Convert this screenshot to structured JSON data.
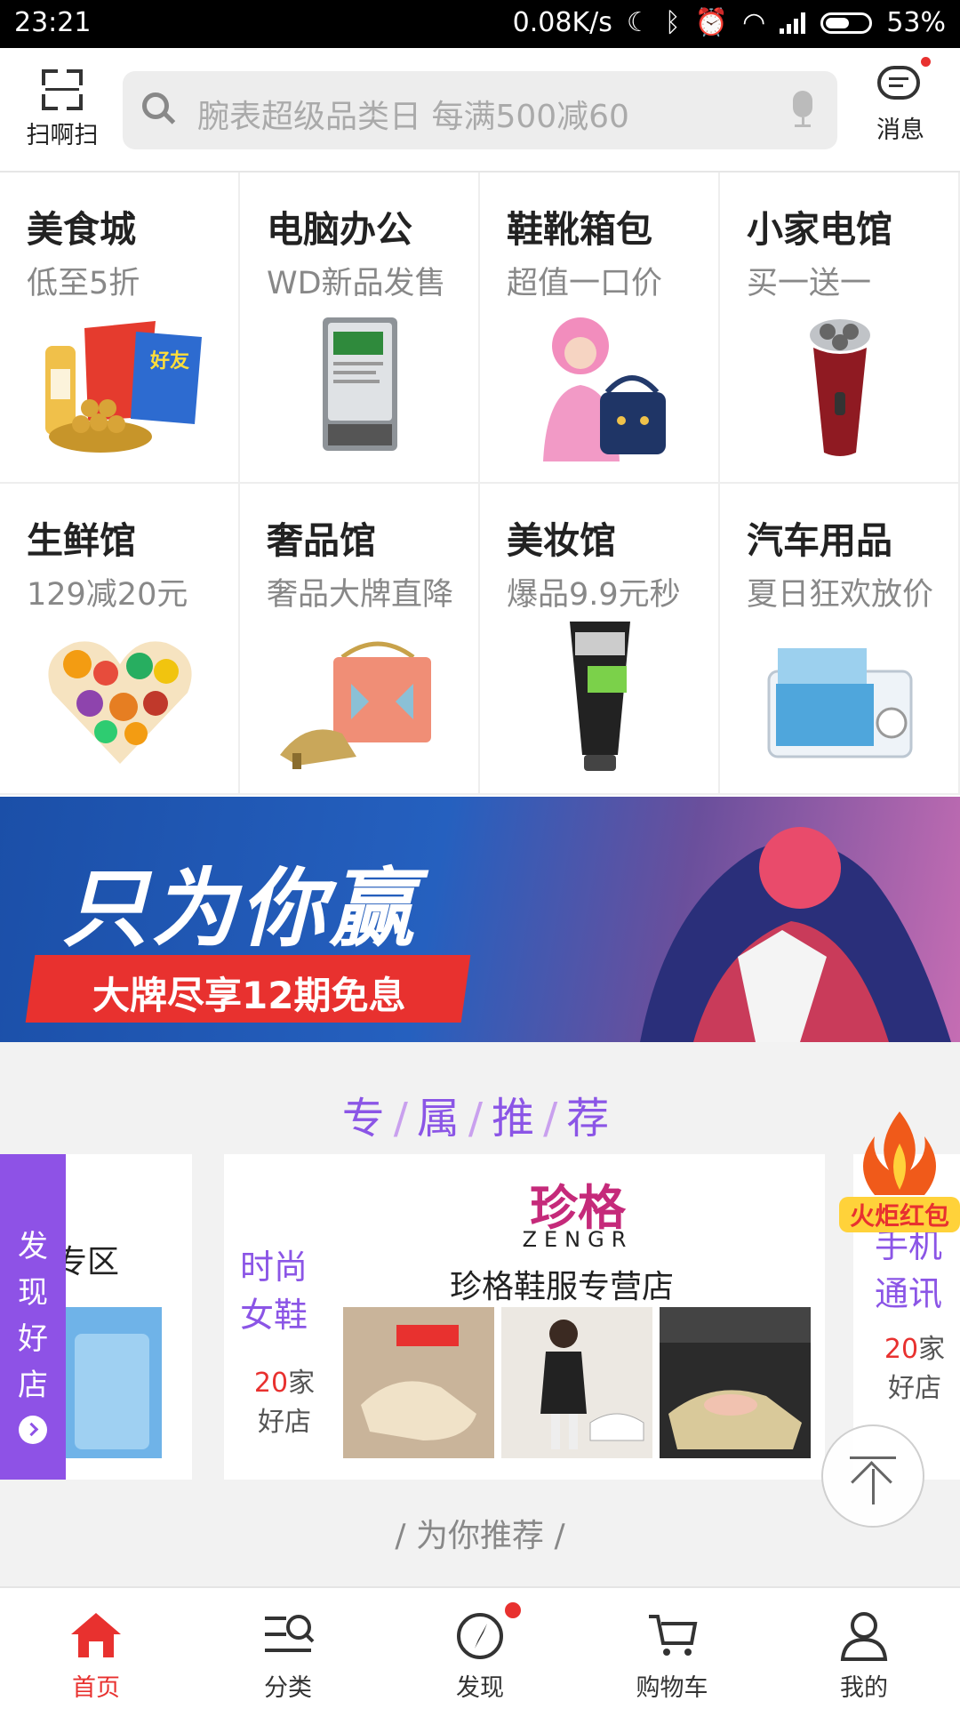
{
  "status_bar": {
    "time": "23:21",
    "speed": "0.08K/s",
    "battery": "53%",
    "battery_level": 0.53
  },
  "header": {
    "scan_label": "扫啊扫",
    "search_placeholder": "腕表超级品类日 每满500减60",
    "message_label": "消息"
  },
  "categories": [
    {
      "title": "美食城",
      "subtitle": "低至5折",
      "icon": "snack-food-image"
    },
    {
      "title": "电脑办公",
      "subtitle": "WD新品发售",
      "icon": "hard-drive-image"
    },
    {
      "title": "鞋靴箱包",
      "subtitle": "超值一口价",
      "icon": "handbag-model-image"
    },
    {
      "title": "小家电馆",
      "subtitle": "买一送一",
      "icon": "electric-shaver-image"
    },
    {
      "title": "生鲜馆",
      "subtitle": "129减20元",
      "icon": "fruit-heart-image"
    },
    {
      "title": "奢品馆",
      "subtitle": "奢品大牌直降",
      "icon": "luxury-bag-shoes-image"
    },
    {
      "title": "美妆馆",
      "subtitle": "爆品9.9元秒",
      "icon": "face-wash-image"
    },
    {
      "title": "汽车用品",
      "subtitle": "夏日狂欢放价",
      "icon": "car-fridge-image"
    }
  ],
  "banner": {
    "headline": "只为你赢",
    "tagline": "大牌尽享12期免息"
  },
  "recommend": {
    "title_chars": [
      "专",
      "属",
      "推",
      "荐"
    ],
    "left_card": {
      "partial_label": "专区"
    },
    "main_card": {
      "brand_logo": "珍格",
      "brand_en": "ZENGR",
      "shop_name": "珍格鞋服专营店",
      "category_lines": [
        "时尚",
        "女鞋"
      ],
      "count_number": "20",
      "count_unit": "家",
      "count_suffix": "好店"
    },
    "right_card": {
      "category_lines": [
        "手机",
        "通讯"
      ],
      "count_number": "20",
      "count_unit": "家",
      "count_suffix": "好店",
      "badge": "火炬红包"
    }
  },
  "discover_panel": {
    "chars": [
      "发",
      "现",
      "好",
      "店"
    ]
  },
  "for_you": "/ 为你推荐 /",
  "tabs": [
    {
      "label": "首页",
      "icon": "home-icon",
      "active": true
    },
    {
      "label": "分类",
      "icon": "category-icon",
      "active": false
    },
    {
      "label": "发现",
      "icon": "compass-icon",
      "active": false,
      "badge": true
    },
    {
      "label": "购物车",
      "icon": "cart-icon",
      "active": false
    },
    {
      "label": "我的",
      "icon": "user-icon",
      "active": false
    }
  ],
  "colors": {
    "brand_red": "#e8312f",
    "purple": "#8b55e6"
  }
}
